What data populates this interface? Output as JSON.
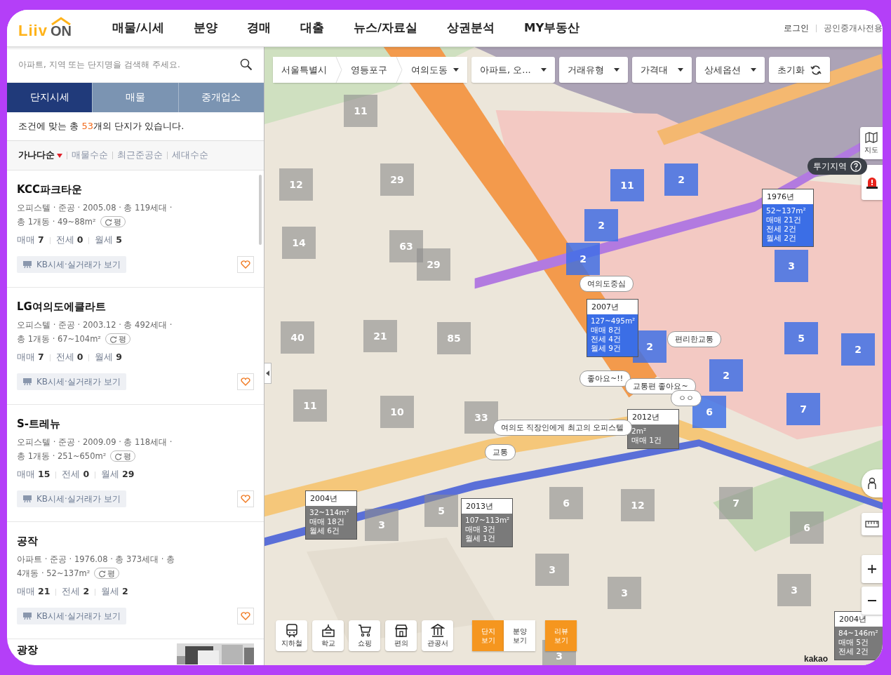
{
  "header": {
    "logo": [
      "Liiv",
      "ON"
    ],
    "nav": [
      "매물/시세",
      "분양",
      "경매",
      "대출",
      "뉴스/자료실",
      "상권분석",
      "MY부동산"
    ],
    "links": [
      "로그인",
      "공인중개사전용"
    ]
  },
  "sidebar": {
    "search": {
      "placeholder": "아파트, 지역 또는 단지명을 검색해 주세요."
    },
    "tabs": [
      {
        "label": "단지시세",
        "selected": true
      },
      {
        "label": "매물",
        "selected": false
      },
      {
        "label": "중개업소",
        "selected": false
      }
    ],
    "summary": {
      "before": "조건에 맞는 총 ",
      "count": "53",
      "after": "개의 단지가 있습니다."
    },
    "sort": [
      {
        "label": "가나다순",
        "selected": true
      },
      {
        "label": "매물수순",
        "selected": false
      },
      {
        "label": "최근준공순",
        "selected": false
      },
      {
        "label": "세대수순",
        "selected": false
      }
    ],
    "complexes": [
      {
        "name": "KCC파크타운",
        "info": "오피스텔 · 준공 · 2005.08 · 총 119세대 ·",
        "info2": "총 1개동 · 49~88m²",
        "unit": "평",
        "deals": [
          {
            "label": "매매",
            "count": "7"
          },
          {
            "label": "전세",
            "count": "0"
          },
          {
            "label": "월세",
            "count": "5"
          }
        ],
        "button": "KB시세·실거래가 보기"
      },
      {
        "name": "LG여의도에클라트",
        "info": "오피스텔 · 준공 · 2003.12 · 총 492세대 ·",
        "info2": "총 1개동 · 67~104m²",
        "unit": "평",
        "deals": [
          {
            "label": "매매",
            "count": "7"
          },
          {
            "label": "전세",
            "count": "0"
          },
          {
            "label": "월세",
            "count": "9"
          }
        ],
        "button": "KB시세·실거래가 보기"
      },
      {
        "name": "S-트레뉴",
        "info": "오피스텔 · 준공 · 2009.09 · 총 118세대 ·",
        "info2": "총 1개동 · 251~650m²",
        "unit": "평",
        "deals": [
          {
            "label": "매매",
            "count": "15"
          },
          {
            "label": "전세",
            "count": "0"
          },
          {
            "label": "월세",
            "count": "29"
          }
        ],
        "button": "KB시세·실거래가 보기"
      },
      {
        "name": "공작",
        "info": "아파트 · 준공 · 1976.08 · 총 373세대 · 총",
        "info2": "4개동 · 52~137m²",
        "unit": "평",
        "deals": [
          {
            "label": "매매",
            "count": "21"
          },
          {
            "label": "전세",
            "count": "2"
          },
          {
            "label": "월세",
            "count": "2"
          }
        ],
        "button": "KB시세·실거래가 보기"
      },
      {
        "name": "광장",
        "thumbnail": {
          "kind": "picture"
        }
      }
    ]
  },
  "map": {
    "picture": {
      "kind": "picture"
    },
    "filters": [
      {
        "label": "서울특별시",
        "kind": "crumb"
      },
      {
        "label": "영등포구",
        "kind": "crumb"
      },
      {
        "label": "여의도동",
        "kind": "crumb-dropdown"
      },
      {
        "label": "아파트, 오...",
        "kind": "dropdown"
      },
      {
        "label": "거래유형",
        "kind": "dropdown"
      },
      {
        "label": "가격대",
        "kind": "dropdown"
      },
      {
        "label": "상세옵션",
        "kind": "dropdown"
      },
      {
        "label": "초기화",
        "kind": "reset"
      }
    ],
    "markers": [
      {
        "count": "11",
        "highlighted": false
      },
      {
        "count": "12",
        "highlighted": false
      },
      {
        "count": "29",
        "highlighted": false
      },
      {
        "count": "11",
        "highlighted": true
      },
      {
        "count": "2",
        "highlighted": true
      },
      {
        "count": "2",
        "highlighted": true
      },
      {
        "count": "14",
        "highlighted": false
      },
      {
        "count": "63",
        "highlighted": false
      },
      {
        "count": "29",
        "highlighted": false
      },
      {
        "count": "2",
        "highlighted": true
      },
      {
        "count": "3",
        "highlighted": true
      },
      {
        "count": "40",
        "highlighted": false
      },
      {
        "count": "21",
        "highlighted": false
      },
      {
        "count": "85",
        "highlighted": false
      },
      {
        "count": "2",
        "highlighted": true
      },
      {
        "count": "5",
        "highlighted": true
      },
      {
        "count": "2",
        "highlighted": true
      },
      {
        "count": "2",
        "highlighted": true
      },
      {
        "count": "11",
        "highlighted": false
      },
      {
        "count": "10",
        "highlighted": false
      },
      {
        "count": "33",
        "highlighted": false
      },
      {
        "count": "6",
        "highlighted": true
      },
      {
        "count": "7",
        "highlighted": true
      },
      {
        "count": "3",
        "highlighted": false
      },
      {
        "count": "5",
        "highlighted": false
      },
      {
        "count": "6",
        "highlighted": false
      },
      {
        "count": "12",
        "highlighted": false
      },
      {
        "count": "7",
        "highlighted": false
      },
      {
        "count": "6",
        "highlighted": false
      },
      {
        "count": "3",
        "highlighted": false
      },
      {
        "count": "3",
        "highlighted": false
      },
      {
        "count": "3",
        "highlighted": false
      },
      {
        "count": "3",
        "highlighted": false
      }
    ],
    "popups": [
      {
        "year": "1976년",
        "lines": [
          "52~137m²",
          "매매 21건",
          "전세 2건",
          "월세 2건"
        ],
        "highlighted": true
      },
      {
        "year": "2007년",
        "lines": [
          "127~495m²",
          "매매 8건",
          "전세 4건",
          "월세 9건"
        ],
        "highlighted": true
      },
      {
        "year": "2012년",
        "lines": [
          "2m²",
          "매매 1건"
        ],
        "highlighted": false
      },
      {
        "year": "2004년",
        "lines": [
          "32~114m²",
          "매매 18건",
          "월세 6건"
        ],
        "highlighted": false
      },
      {
        "year": "2013년",
        "lines": [
          "107~113m²",
          "매매 3건",
          "월세 1건"
        ],
        "highlighted": false
      },
      {
        "year": "2004년",
        "lines": [
          "84~146m²",
          "매매 5건",
          "전세 2건"
        ],
        "highlighted": false
      }
    ],
    "reviews": [
      "여의도중심",
      "편리한교통",
      "좋아요~!!",
      "교통편 좋아요~",
      "ㅇㅇ",
      "여의도 직장인에게 최고의 오피스텔",
      "교통"
    ],
    "map_type": "지도",
    "tooltip": "투기지역",
    "categories": [
      {
        "label": "지하철",
        "kind": "subway"
      },
      {
        "label": "학교",
        "kind": "school"
      },
      {
        "label": "쇼핑",
        "kind": "shopping"
      },
      {
        "label": "편의",
        "kind": "store"
      },
      {
        "label": "관공서",
        "kind": "office"
      }
    ],
    "views": [
      {
        "label": "단지\n보기",
        "selected": true
      },
      {
        "label": "분양\n보기",
        "selected": false
      },
      {
        "label": "리뷰\n보기",
        "selected": true
      }
    ],
    "attribution": "kakao"
  }
}
